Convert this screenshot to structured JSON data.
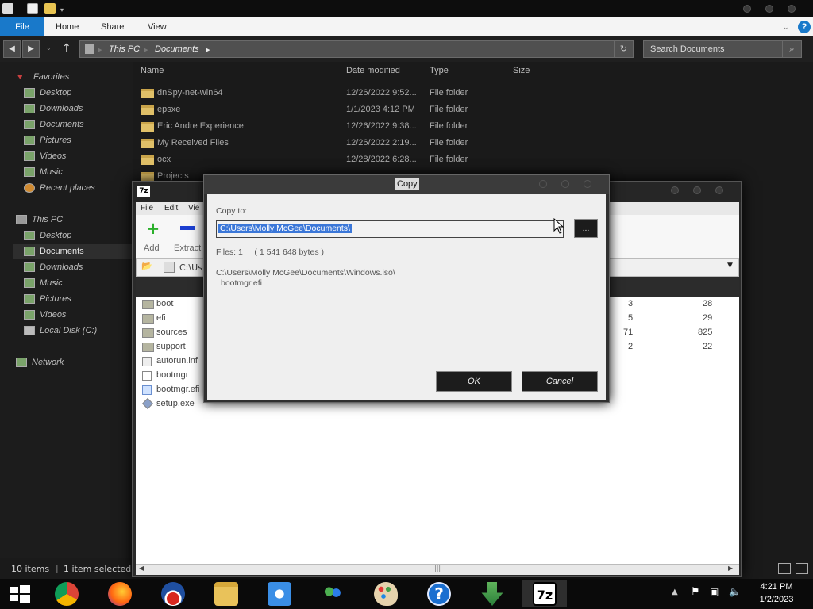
{
  "explorer": {
    "ribbon_tabs": [
      "File",
      "Home",
      "Share",
      "View"
    ],
    "breadcrumb": [
      "This PC",
      "Documents"
    ],
    "search_placeholder": "Search Documents",
    "columns": [
      "Name",
      "Date modified",
      "Type",
      "Size"
    ],
    "rows": [
      {
        "name": "dnSpy-net-win64",
        "date": "12/26/2022 9:52...",
        "type": "File folder"
      },
      {
        "name": "epsxe",
        "date": "1/1/2023 4:12 PM",
        "type": "File folder"
      },
      {
        "name": "Eric Andre Experience",
        "date": "12/26/2022 9:38...",
        "type": "File folder"
      },
      {
        "name": "My Received Files",
        "date": "12/26/2022 2:19...",
        "type": "File folder"
      },
      {
        "name": "ocx",
        "date": "12/28/2022 6:28...",
        "type": "File folder"
      },
      {
        "name": "Projects",
        "date": "",
        "type": ""
      }
    ],
    "nav": {
      "favorites": "Favorites",
      "fav_items": [
        "Desktop",
        "Downloads",
        "Documents",
        "Pictures",
        "Videos",
        "Music",
        "Recent places"
      ],
      "thispc": "This PC",
      "pc_items": [
        "Desktop",
        "Documents",
        "Downloads",
        "Music",
        "Pictures",
        "Videos",
        "Local Disk (C:)"
      ],
      "network": "Network"
    },
    "status": {
      "count": "10 items",
      "selected": "1 item selected"
    }
  },
  "zip": {
    "app_icon": "7z",
    "menu": [
      "File",
      "Edit",
      "Vie"
    ],
    "toolbar": {
      "add": "Add",
      "extract": "Extract"
    },
    "path": "C:\\Us",
    "rows": [
      {
        "name": "boot",
        "a": "3",
        "b": "28"
      },
      {
        "name": "efi",
        "a": "5",
        "b": "29"
      },
      {
        "name": "sources",
        "a": "71",
        "b": "825"
      },
      {
        "name": "support",
        "a": "2",
        "b": "22"
      },
      {
        "name": "autorun.inf",
        "a": "",
        "b": ""
      },
      {
        "name": "bootmgr",
        "a": "",
        "b": ""
      },
      {
        "name": "bootmgr.efi",
        "a": "",
        "b": ""
      },
      {
        "name": "setup.exe",
        "a": "",
        "b": ""
      }
    ]
  },
  "dialog": {
    "title": "Copy",
    "copy_to_label": "Copy to:",
    "dest_path": "C:\\Users\\Molly McGee\\Documents\\",
    "browse_label": "...",
    "files_info": "Files: 1     ( 1 541 648 bytes )",
    "src_line1": "C:\\Users\\Molly McGee\\Documents\\Windows.iso\\",
    "src_line2": "bootmgr.efi",
    "ok": "OK",
    "cancel": "Cancel"
  },
  "taskbar": {
    "icons": [
      "windows-start-icon",
      "chrome-icon",
      "firefox-icon",
      "obama-logo-icon",
      "file-explorer-icon",
      "sun-app-icon",
      "people-icon",
      "paint-icon",
      "help-icon",
      "download-icon",
      "7zip-icon"
    ],
    "zip_label": "7z",
    "help_label": "?",
    "time": "4:21 PM",
    "date": "1/2/2023"
  }
}
